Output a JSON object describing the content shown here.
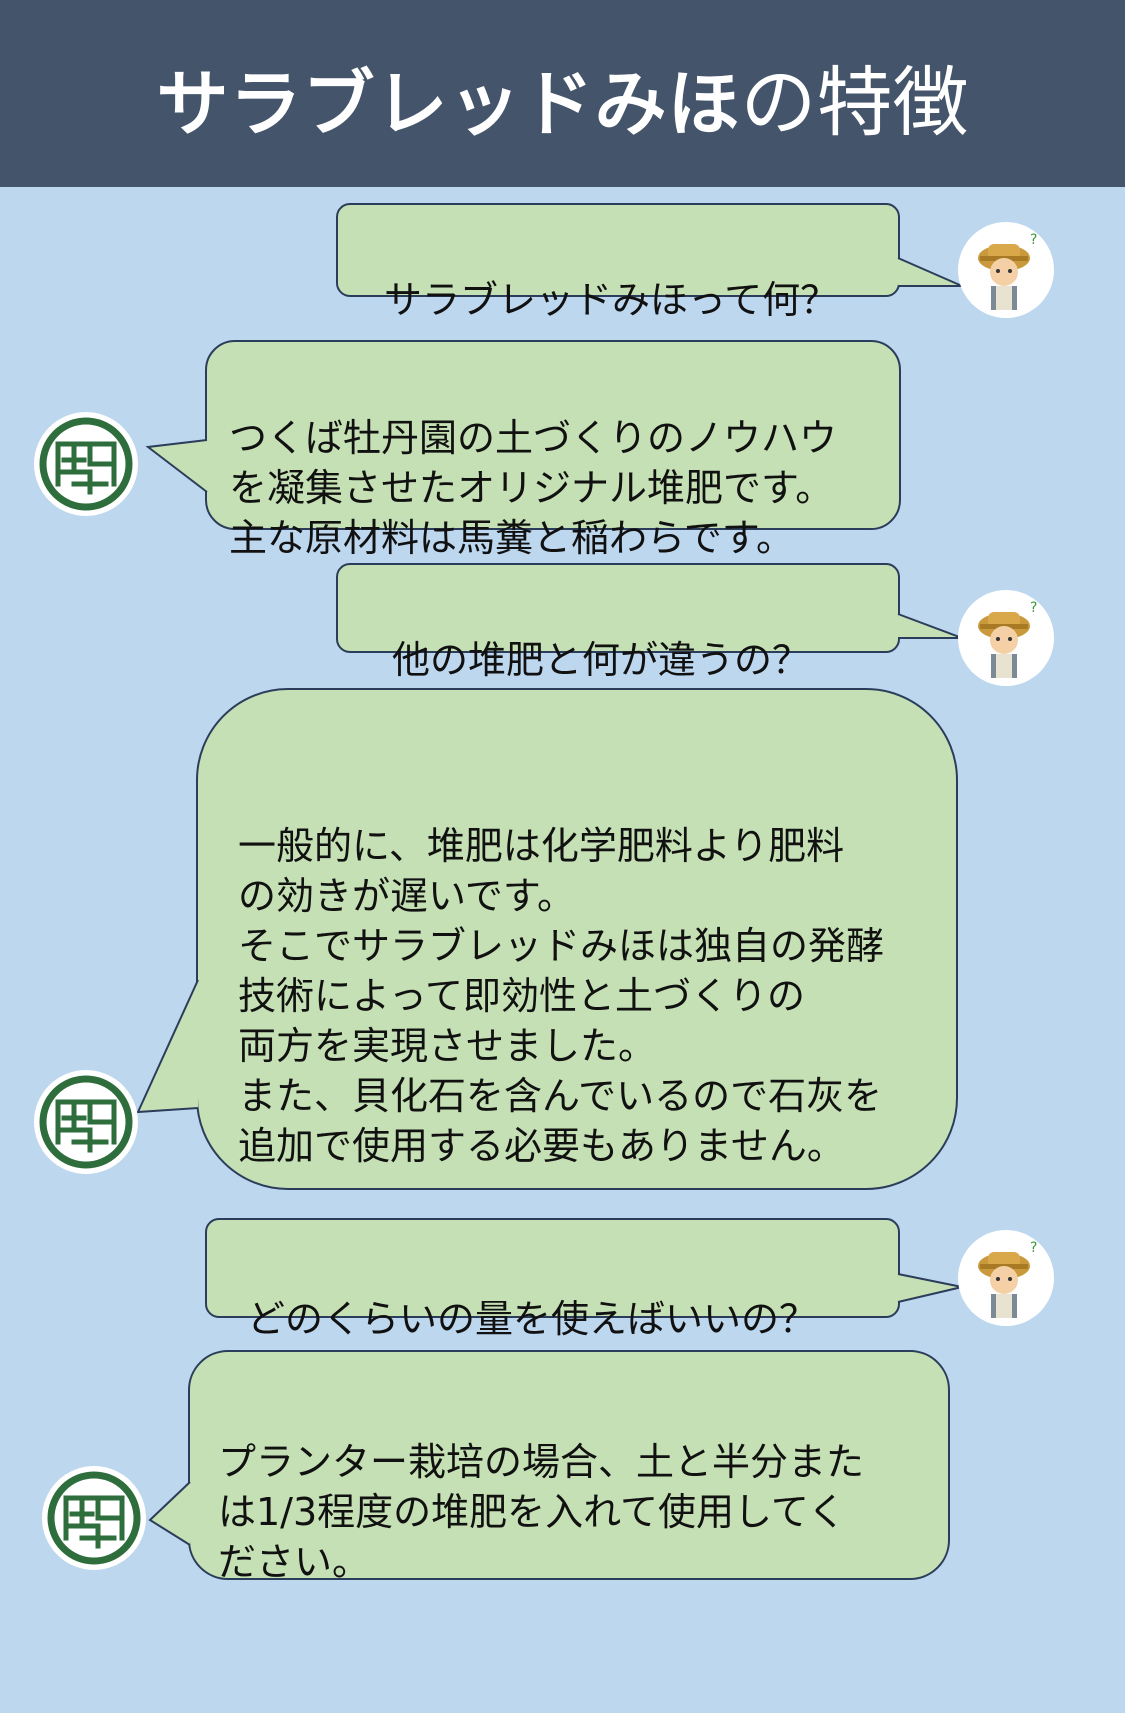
{
  "header": {
    "title_bold": "サラブレッドみほ",
    "title_rest": "の特徴",
    "background_color": "#44546a"
  },
  "colors": {
    "page_background": "#bdd7ee",
    "bubble_fill": "#c5e0b4",
    "bubble_border": "#2b3d5a",
    "logo_green": "#2e6e3c"
  },
  "conversation": [
    {
      "speaker": "farmer",
      "icon": "farmer-avatar-icon",
      "text": "サラブレッドみほって何？"
    },
    {
      "speaker": "shop",
      "icon": "shop-logo-icon",
      "text": "つくば牡丹園の土づくりのノウハウ\nを凝集させたオリジナル堆肥です。\n主な原材料は馬糞と稲わらです。"
    },
    {
      "speaker": "farmer",
      "icon": "farmer-avatar-icon",
      "text": "他の堆肥と何が違うの？"
    },
    {
      "speaker": "shop",
      "icon": "shop-logo-icon",
      "text": "一般的に、堆肥は化学肥料より肥料\nの効きが遅いです。\nそこでサラブレッドみほは独自の発酵\n技術によって即効性と土づくりの\n両方を実現させました。\nまた、貝化石を含んでいるので石灰を\n追加で使用する必要もありません。"
    },
    {
      "speaker": "farmer",
      "icon": "farmer-avatar-icon",
      "text": "どのくらいの量を使えばいいの？"
    },
    {
      "speaker": "shop",
      "icon": "shop-logo-icon",
      "text": "プランター栽培の場合、土と半分また\nは1/3程度の堆肥を入れて使用してく\nださい。"
    }
  ]
}
